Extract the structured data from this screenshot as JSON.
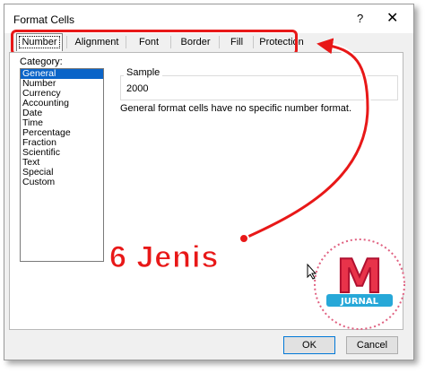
{
  "window": {
    "title": "Format Cells",
    "help_glyph": "?",
    "close_glyph": "✕"
  },
  "tabs": [
    {
      "label": "Number",
      "active": true
    },
    {
      "label": "Alignment"
    },
    {
      "label": "Font"
    },
    {
      "label": "Border"
    },
    {
      "label": "Fill"
    },
    {
      "label": "Protection"
    }
  ],
  "category": {
    "label": "Category:",
    "items": [
      "General",
      "Number",
      "Currency",
      "Accounting",
      "Date",
      "Time",
      "Percentage",
      "Fraction",
      "Scientific",
      "Text",
      "Special",
      "Custom"
    ],
    "selected": "General"
  },
  "sample": {
    "label": "Sample",
    "value": "2000"
  },
  "description": "General format cells have no specific number format.",
  "buttons": {
    "ok": "OK",
    "cancel": "Cancel"
  },
  "annotation": {
    "text": "6 Jenis",
    "color": "#e81818"
  },
  "logo": {
    "letter": "M",
    "ribbon": "JURNAL"
  }
}
